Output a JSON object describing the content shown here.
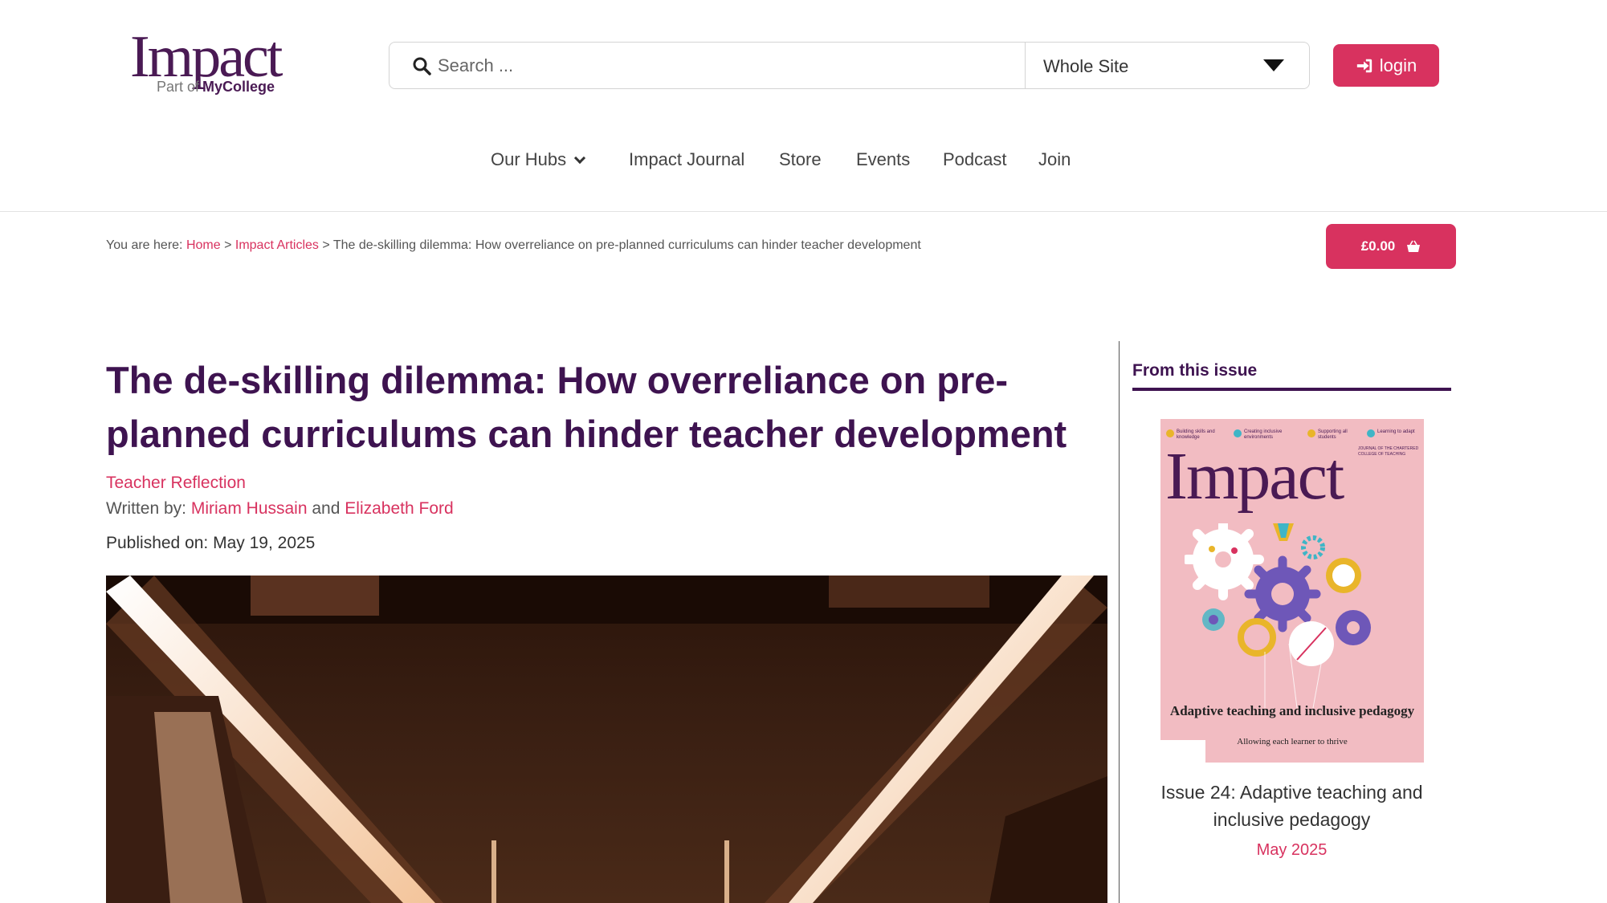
{
  "header": {
    "logo": {
      "word": "Impact",
      "part_of": "Part of",
      "brand": "MyCollege"
    },
    "search": {
      "placeholder": "Search ...",
      "scope": "Whole Site"
    },
    "login_label": "login"
  },
  "nav": {
    "items": [
      "Our Hubs",
      "Impact Journal",
      "Store",
      "Events",
      "Podcast",
      "Join"
    ]
  },
  "breadcrumb": {
    "prefix": "You are here:",
    "home": "Home",
    "section": "Impact Articles",
    "separator": ">",
    "current": "The de-skilling dilemma: How overreliance on pre-planned curriculums can hinder teacher development"
  },
  "cart": {
    "amount": "£0.00"
  },
  "article": {
    "title": "The de-skilling dilemma: How overreliance on pre-planned curriculums can hinder teacher development",
    "category": "Teacher Reflection",
    "written_by_label": "Written by:",
    "authors": [
      "Miriam Hussain",
      "Elizabeth Ford"
    ],
    "author_conjunction": "and",
    "published_label": "Published on:",
    "published_date": "May 19, 2025"
  },
  "sidebar": {
    "heading": "From this issue",
    "cover": {
      "title": "Impact",
      "themes": [
        "Building skills and knowledge",
        "Creating inclusive environments",
        "Supporting all students",
        "Learning to adapt"
      ],
      "journal_line": "JOURNAL OF THE CHARTERED COLLEGE OF TEACHING",
      "subtitle": "Adaptive teaching and inclusive pedagogy",
      "tagline": "Allowing each learner to thrive"
    },
    "issue_title": "Issue 24: Adaptive teaching and inclusive pedagogy",
    "issue_date": "May 2025"
  },
  "colors": {
    "brand_purple": "#3e1350",
    "accent_pink": "#d8325f",
    "cover_pink": "#f2bcc2"
  }
}
